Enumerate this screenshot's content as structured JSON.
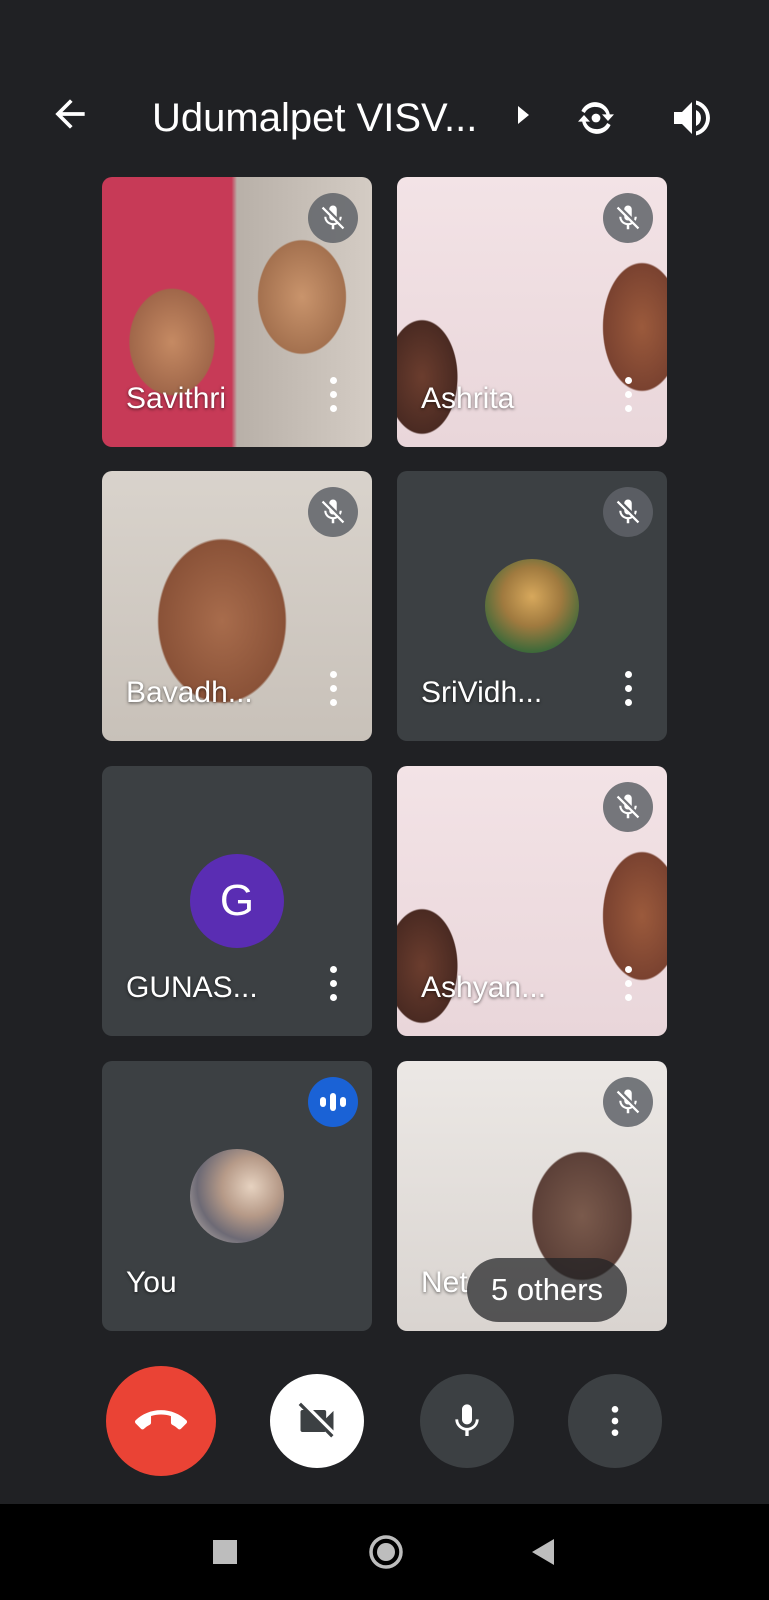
{
  "header": {
    "title": "Udumalpet VISV..."
  },
  "participants": [
    {
      "name": "Savithri"
    },
    {
      "name": "Ashrita"
    },
    {
      "name": "Bavadh..."
    },
    {
      "name": "SriVidh..."
    },
    {
      "name": "GUNAS...",
      "avatar_letter": "G"
    },
    {
      "name": "Ashyan..."
    },
    {
      "name": "You"
    },
    {
      "name": "Net"
    }
  ],
  "others_pill": "5 others",
  "colors": {
    "background": "#202124",
    "tile": "#3c4043",
    "hangup": "#ea4335",
    "speaking_badge": "#1a62d6",
    "avatar_g": "#5a2db3"
  },
  "icons": [
    "back-arrow-icon",
    "chevron-right-icon",
    "flip-camera-icon",
    "speaker-icon",
    "mic-off-icon",
    "more-vert-icon",
    "speaking-indicator-icon",
    "hang-up-icon",
    "camera-off-icon",
    "mic-icon",
    "square-icon",
    "circle-icon",
    "triangle-back-icon"
  ]
}
